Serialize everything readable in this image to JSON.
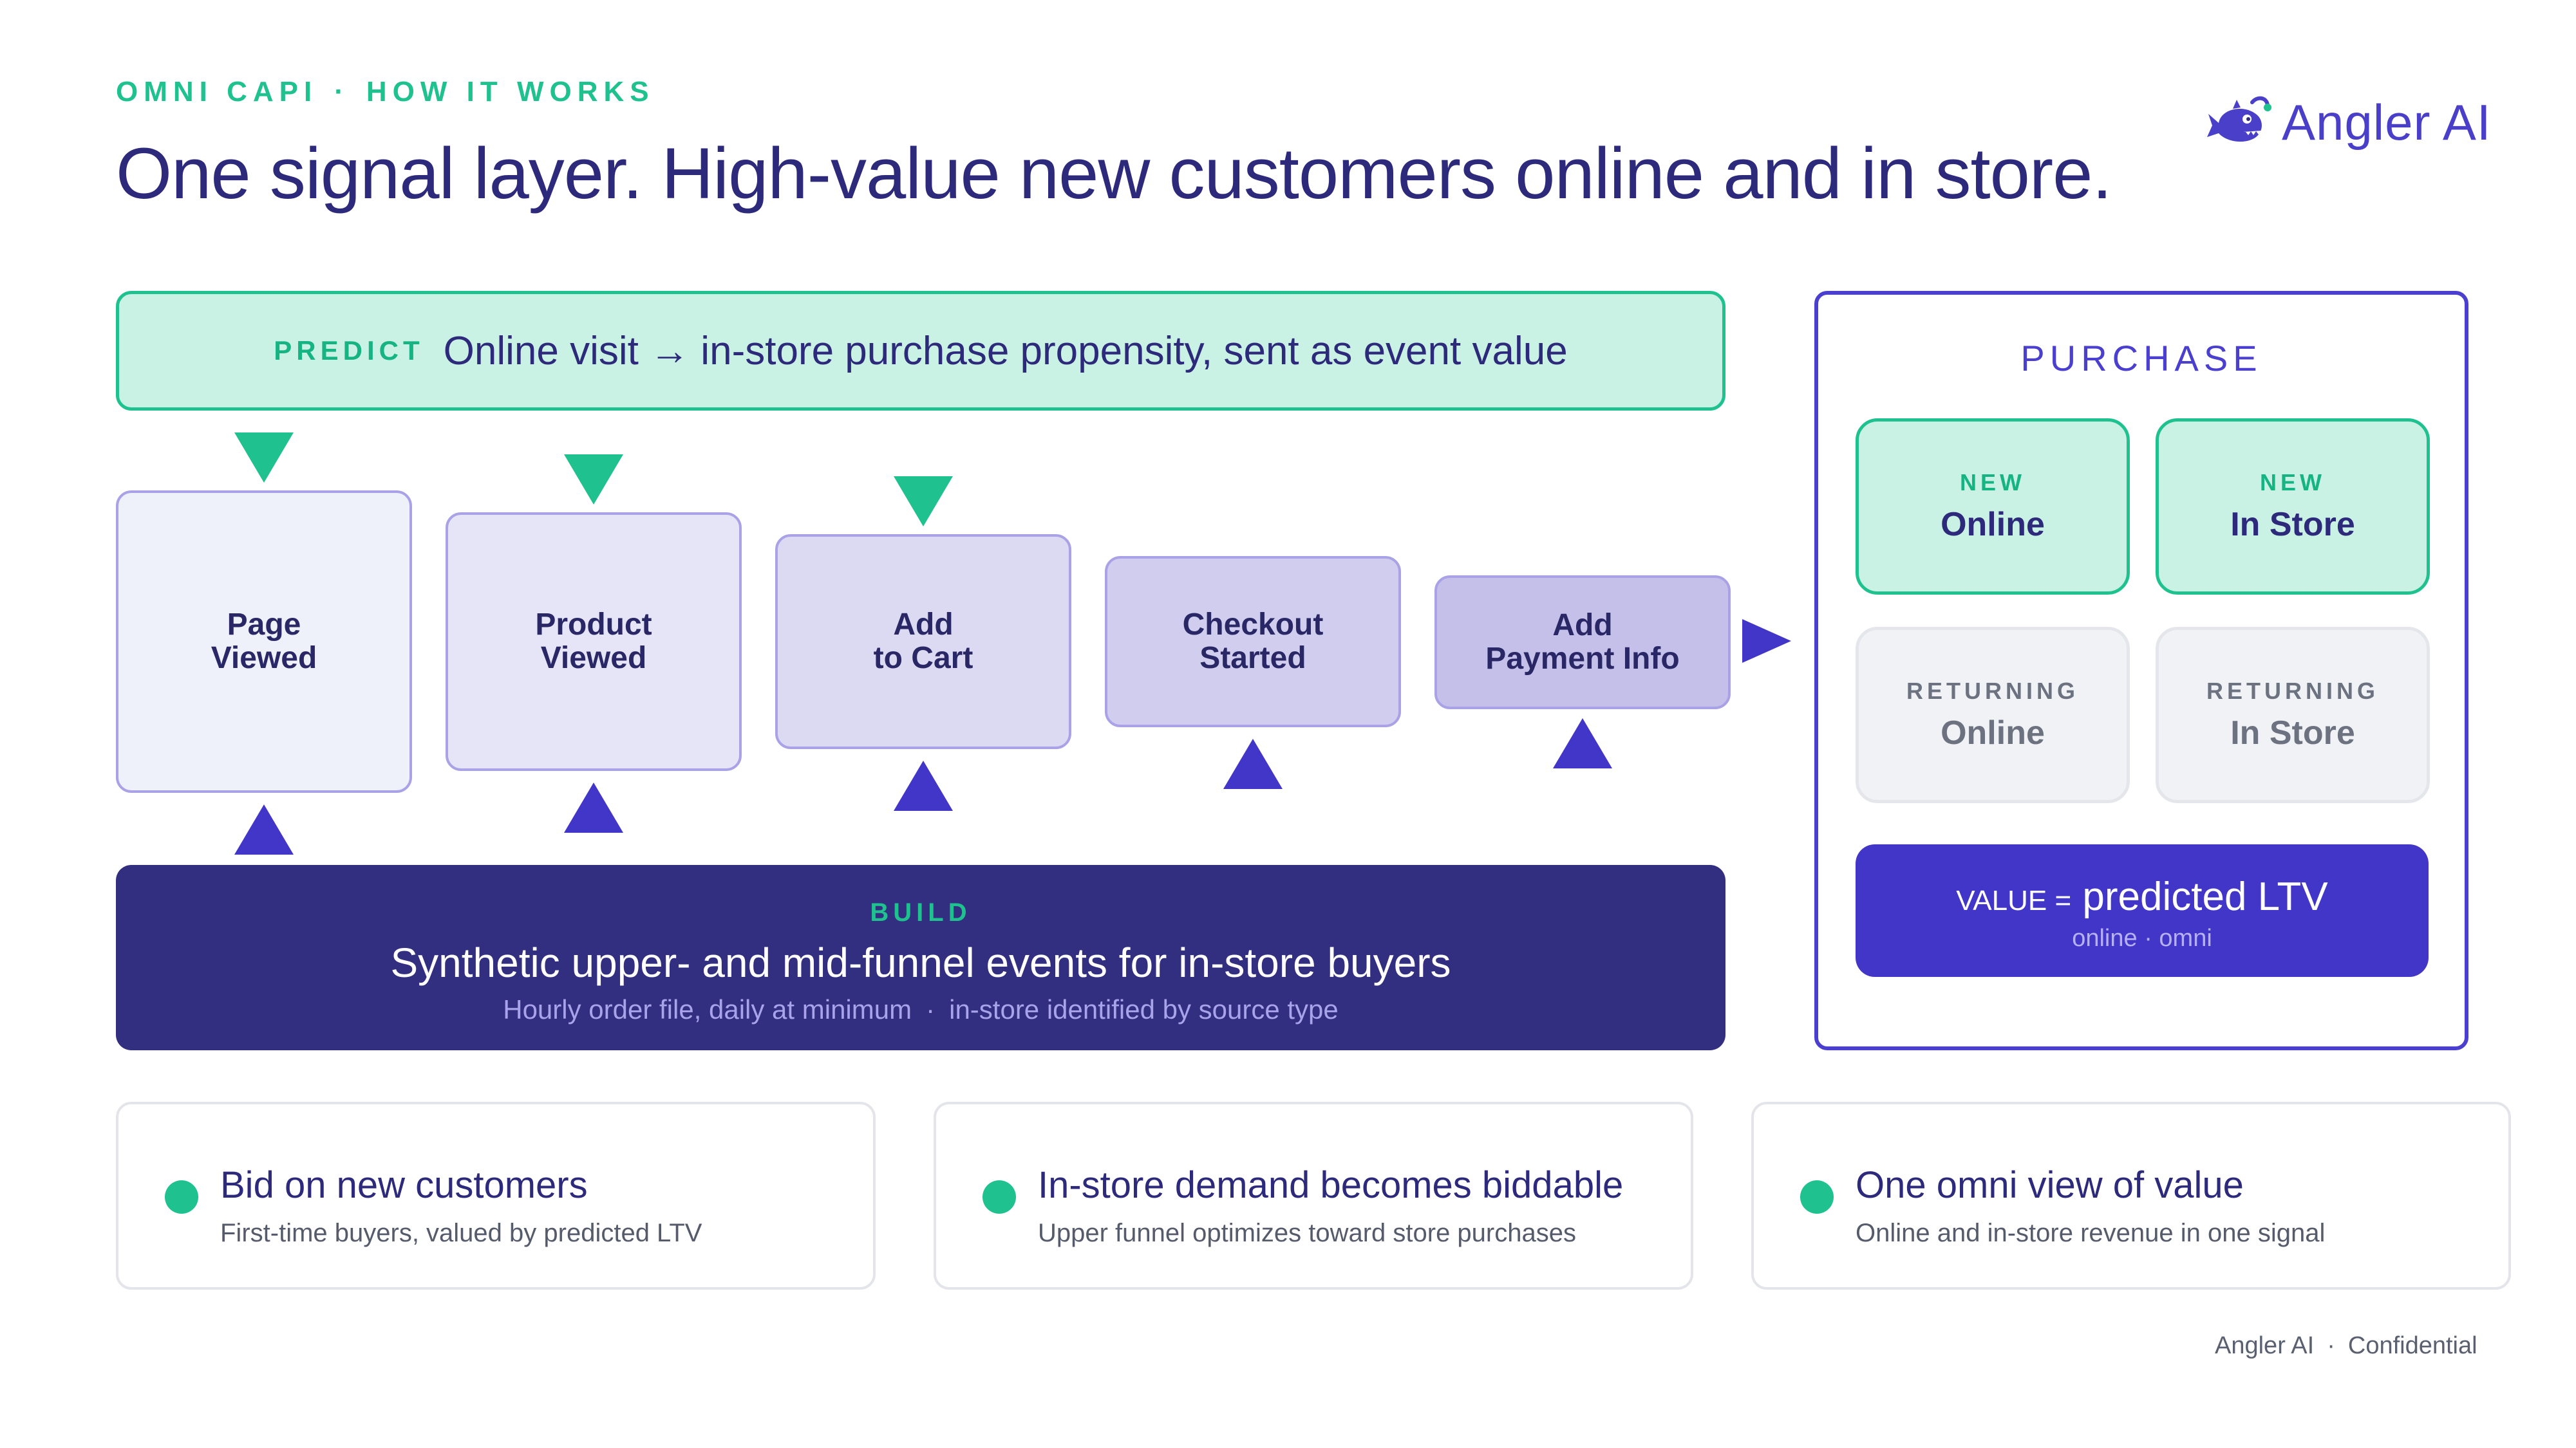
{
  "header": {
    "eyebrow_left": "OMNI CAPI",
    "eyebrow_sep": "·",
    "eyebrow_right": "HOW IT WORKS",
    "title": "One signal layer. High-value new customers online and in store.",
    "logo_text": "Angler AI"
  },
  "predict": {
    "tag": "PREDICT",
    "text": "Online visit → in-store purchase propensity, sent as event value"
  },
  "funnel": {
    "steps": [
      {
        "line1": "Page",
        "line2": "Viewed",
        "color": "#eef0fa"
      },
      {
        "line1": "Product",
        "line2": "Viewed",
        "color": "#e6e4f7"
      },
      {
        "line1": "Add",
        "line2": "to Cart",
        "color": "#dcd9f3"
      },
      {
        "line1": "Checkout",
        "line2": "Started",
        "color": "#d0cdee"
      },
      {
        "line1": "Add",
        "line2": "Payment Info",
        "color": "#c4c0ea"
      }
    ]
  },
  "build": {
    "tag": "BUILD",
    "main": "Synthetic upper- and mid-funnel events for in-store buyers",
    "sub_left": "Hourly order file, daily at minimum",
    "sub_sep": "·",
    "sub_right": "in-store identified by source type"
  },
  "purchase": {
    "title": "PURCHASE",
    "cells": [
      {
        "kind": "NEW",
        "channel": "Online"
      },
      {
        "kind": "NEW",
        "channel": "In Store"
      },
      {
        "kind": "RETURNING",
        "channel": "Online"
      },
      {
        "kind": "RETURNING",
        "channel": "In Store"
      }
    ],
    "value_label": "VALUE =",
    "value_text": "predicted LTV",
    "value_sub": "online · omni"
  },
  "benefits": [
    {
      "title": "Bid on new customers",
      "subtitle": "First-time buyers, valued by predicted LTV"
    },
    {
      "title": "In-store demand becomes biddable",
      "subtitle": "Upper funnel optimizes toward store purchases"
    },
    {
      "title": "One omni view of value",
      "subtitle": "Online and in-store revenue in one signal"
    }
  ],
  "footer": {
    "left": "Angler AI",
    "sep": "·",
    "right": "Confidential"
  },
  "colors": {
    "accent_green": "#1fc28f",
    "brand_navy": "#2d2a7c",
    "brand_purple": "#4136c7",
    "build_bg": "#322e80"
  },
  "icons": {
    "logo": "anglerfish-icon",
    "predict_arrows": "triangle-down-icon",
    "build_arrows": "triangle-up-icon",
    "flow_arrow": "triangle-right-icon",
    "benefit_bullet": "dot-icon"
  }
}
